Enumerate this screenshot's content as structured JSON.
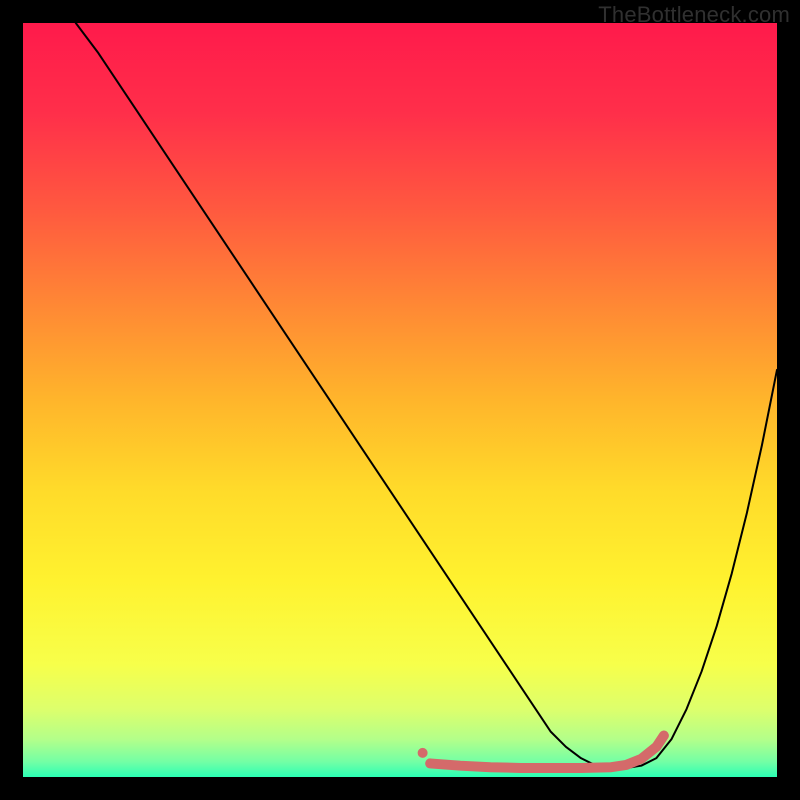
{
  "watermark": "TheBottleneck.com",
  "chart_data": {
    "type": "line",
    "title": "",
    "xlabel": "",
    "ylabel": "",
    "xlim": [
      0,
      100
    ],
    "ylim": [
      0,
      100
    ],
    "background_gradient": {
      "stops": [
        {
          "offset": 0.0,
          "color": "#ff1a4b"
        },
        {
          "offset": 0.12,
          "color": "#ff2f4a"
        },
        {
          "offset": 0.25,
          "color": "#ff5a3f"
        },
        {
          "offset": 0.38,
          "color": "#ff8a34"
        },
        {
          "offset": 0.5,
          "color": "#ffb52b"
        },
        {
          "offset": 0.62,
          "color": "#ffdb2a"
        },
        {
          "offset": 0.74,
          "color": "#fff22f"
        },
        {
          "offset": 0.85,
          "color": "#f7ff4a"
        },
        {
          "offset": 0.91,
          "color": "#ddff6c"
        },
        {
          "offset": 0.95,
          "color": "#b3ff8a"
        },
        {
          "offset": 0.98,
          "color": "#73ffa5"
        },
        {
          "offset": 1.0,
          "color": "#2bffb4"
        }
      ]
    },
    "series": [
      {
        "name": "bottleneck-curve",
        "color": "#000000",
        "width": 2,
        "x": [
          7,
          10,
          15,
          20,
          25,
          30,
          35,
          40,
          45,
          50,
          52,
          54,
          56,
          58,
          60,
          62,
          64,
          66,
          68,
          70,
          72,
          74,
          76,
          78,
          80,
          82,
          84,
          86,
          88,
          90,
          92,
          94,
          96,
          98,
          100
        ],
        "y": [
          100,
          96,
          88.5,
          81,
          73.5,
          66,
          58.5,
          51,
          43.5,
          36,
          33,
          30,
          27,
          24,
          21,
          18,
          15,
          12,
          9,
          6,
          4,
          2.5,
          1.5,
          1.2,
          1.2,
          1.5,
          2.5,
          5,
          9,
          14,
          20,
          27,
          35,
          44,
          54
        ]
      },
      {
        "name": "highlight-segment",
        "color": "#d46a6a",
        "width": 10,
        "x": [
          54,
          58,
          62,
          66,
          70,
          74,
          78,
          80,
          82,
          84,
          85
        ],
        "y": [
          1.8,
          1.5,
          1.3,
          1.2,
          1.2,
          1.2,
          1.3,
          1.6,
          2.4,
          4.0,
          5.5
        ]
      }
    ],
    "markers": [
      {
        "name": "highlight-dot",
        "x": 53,
        "y": 3.2,
        "r": 5,
        "color": "#d46a6a"
      }
    ]
  }
}
